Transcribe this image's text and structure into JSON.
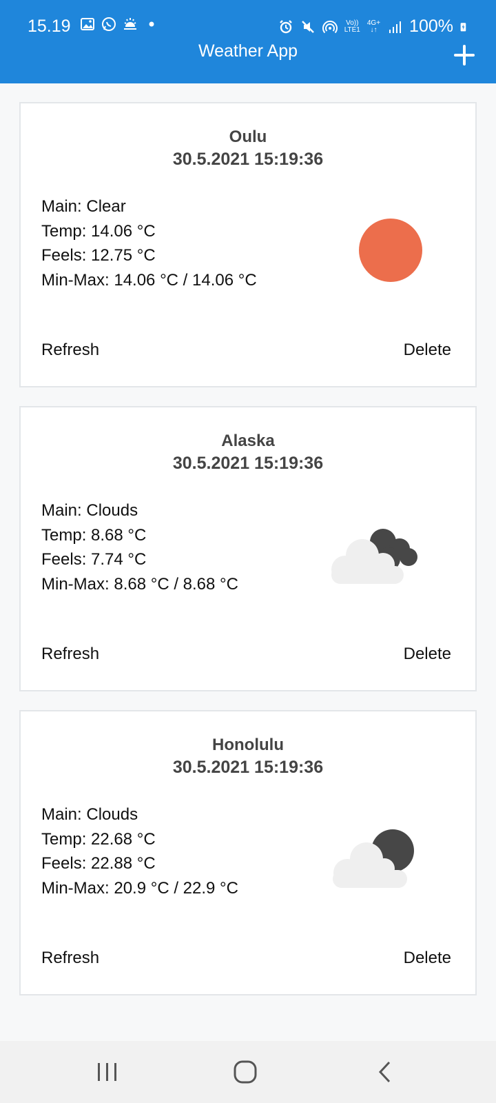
{
  "status_bar": {
    "time": "15.19",
    "battery": "100%",
    "volte": "Vo))",
    "lte": "LTE1",
    "network": "4G+"
  },
  "app_bar": {
    "title": "Weather App",
    "add_icon": "plus-icon"
  },
  "cards": [
    {
      "city": "Oulu",
      "datetime": "30.5.2021 15:19:36",
      "main": "Main: Clear",
      "temp": "Temp: 14.06 °C",
      "feels": "Feels: 12.75 °C",
      "minmax": "Min-Max: 14.06 °C / 14.06 °C",
      "icon": "clear-sun-icon",
      "refresh_label": "Refresh",
      "delete_label": "Delete"
    },
    {
      "city": "Alaska",
      "datetime": "30.5.2021 15:19:36",
      "main": "Main: Clouds",
      "temp": "Temp: 8.68 °C",
      "feels": "Feels: 7.74 °C",
      "minmax": "Min-Max: 8.68 °C / 8.68 °C",
      "icon": "broken-clouds-icon",
      "refresh_label": "Refresh",
      "delete_label": "Delete"
    },
    {
      "city": "Honolulu",
      "datetime": "30.5.2021 15:19:36",
      "main": "Main: Clouds",
      "temp": "Temp: 22.68 °C",
      "feels": "Feels: 22.88 °C",
      "minmax": "Min-Max: 20.9 °C / 22.9 °C",
      "icon": "scattered-clouds-icon",
      "refresh_label": "Refresh",
      "delete_label": "Delete"
    }
  ],
  "colors": {
    "primary": "#1f86db",
    "sun": "#ec6e4c",
    "dark_cloud": "#474747",
    "light_cloud": "#efefef"
  }
}
